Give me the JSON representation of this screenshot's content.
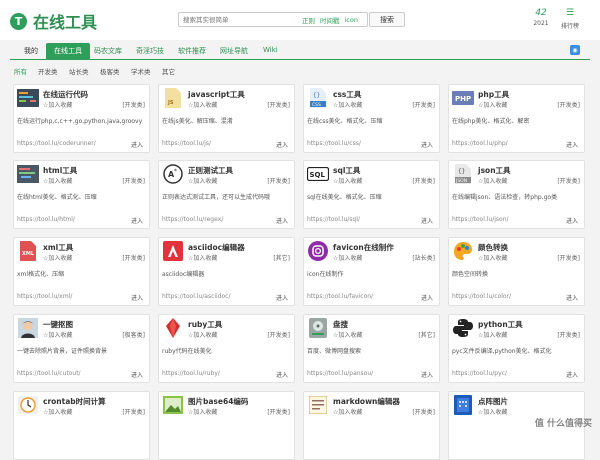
{
  "header": {
    "logo_text": "在线工具",
    "search_placeholder": "搜索其实很简单",
    "search_tags": [
      "正则",
      "时间戳",
      "icon"
    ],
    "search_button": "搜索",
    "year_num": "42",
    "year_label": "2021",
    "rank_label": "排行榜"
  },
  "nav": {
    "items": [
      "我的",
      "在线工具",
      "码农文库",
      "奇淫巧技",
      "软件推荐",
      "网址导航",
      "Wiki"
    ]
  },
  "subnav": {
    "items": [
      "所有",
      "开发类",
      "站长类",
      "极客类",
      "学术类",
      "其它"
    ]
  },
  "tool_cards": [
    {
      "title": "在线运行代码",
      "fav": "☆加入收藏",
      "category": "[开发类]",
      "desc": "在线运行php,c,c++,go,python,java,groovy",
      "url": "https://tool.lu/coderunner/",
      "enter": "进入"
    },
    {
      "title": "javascript工具",
      "fav": "☆加入收藏",
      "category": "[开发类]",
      "desc": "在线js美化、解压缩、混淆",
      "url": "https://tool.lu/js/",
      "enter": "进入"
    },
    {
      "title": "css工具",
      "fav": "☆加入收藏",
      "category": "[开发类]",
      "desc": "在线css美化、格式化、压缩",
      "url": "https://tool.lu/css/",
      "enter": "进入"
    },
    {
      "title": "php工具",
      "fav": "☆加入收藏",
      "category": "[开发类]",
      "desc": "在线php美化、格式化、解密",
      "url": "https://tool.lu/php/",
      "enter": "进入"
    },
    {
      "title": "html工具",
      "fav": "☆加入收藏",
      "category": "[开发类]",
      "desc": "在线html美化、格式化、压缩",
      "url": "https://tool.lu/html/",
      "enter": "进入"
    },
    {
      "title": "正则测试工具",
      "fav": "☆加入收藏",
      "category": "[开发类]",
      "desc": "正则表达式测试工具，还可以生成代码哦",
      "url": "https://tool.lu/regex/",
      "enter": "进入"
    },
    {
      "title": "sql工具",
      "fav": "☆加入收藏",
      "category": "[开发类]",
      "desc": "sql在线美化、格式化、压缩",
      "url": "https://tool.lu/sql/",
      "enter": "进入"
    },
    {
      "title": "json工具",
      "fav": "☆加入收藏",
      "category": "[开发类]",
      "desc": "在线编辑json、语法检查，转php,go类",
      "url": "https://tool.lu/json/",
      "enter": "进入"
    },
    {
      "title": "xml工具",
      "fav": "☆加入收藏",
      "category": "[开发类]",
      "desc": "xml格式化、压缩",
      "url": "https://tool.lu/xml/",
      "enter": "进入"
    },
    {
      "title": "asciidoc编辑器",
      "fav": "☆加入收藏",
      "category": "[其它]",
      "desc": "asciidoc编辑器",
      "url": "https://tool.lu/asciidoc/",
      "enter": "进入"
    },
    {
      "title": "favicon在线制作",
      "fav": "☆加入收藏",
      "category": "[站长类]",
      "desc": "icon在线制作",
      "url": "https://tool.lu/favicon/",
      "enter": "进入"
    },
    {
      "title": "颜色转换",
      "fav": "☆加入收藏",
      "category": "[开发类]",
      "desc": "颜色空间转换",
      "url": "https://tool.lu/color/",
      "enter": "进入"
    },
    {
      "title": "一键抠图",
      "fav": "☆加入收藏",
      "category": "[极客类]",
      "desc": "一键去除照片背景，证件照换背景",
      "url": "https://tool.lu/cutout/",
      "enter": "进入"
    },
    {
      "title": "ruby工具",
      "fav": "☆加入收藏",
      "category": "[开发类]",
      "desc": "ruby代码在线美化",
      "url": "https://tool.lu/ruby/",
      "enter": "进入"
    },
    {
      "title": "盘搜",
      "fav": "☆加入收藏",
      "category": "[其它]",
      "desc": "百度、微博网盘搜索",
      "url": "https://tool.lu/pansou/",
      "enter": "进入"
    },
    {
      "title": "python工具",
      "fav": "☆加入收藏",
      "category": "[开发类]",
      "desc": "pyc文件反编译,python美化、格式化",
      "url": "https://tool.lu/pyc/",
      "enter": "进入"
    },
    {
      "title": "crontab时间计算",
      "fav": "☆加入收藏",
      "category": "[开发类]",
      "desc": "",
      "url": "",
      "enter": ""
    },
    {
      "title": "图片base64编码",
      "fav": "☆加入收藏",
      "category": "[开发类]",
      "desc": "",
      "url": "",
      "enter": ""
    },
    {
      "title": "markdown编辑器",
      "fav": "☆加入收藏",
      "category": "[开发类]",
      "desc": "",
      "url": "",
      "enter": ""
    },
    {
      "title": "点阵图片",
      "fav": "☆加入收藏",
      "category": "",
      "desc": "",
      "url": "",
      "enter": ""
    }
  ],
  "watermark": "值 什么值得买",
  "icons": {
    "brand": "#2f9e5a"
  }
}
